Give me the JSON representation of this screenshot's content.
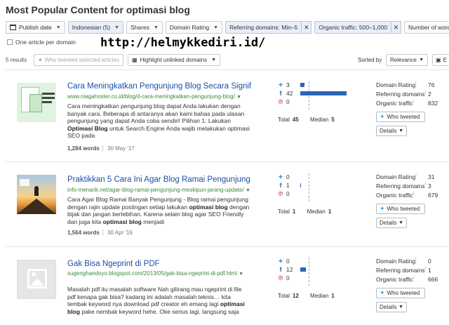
{
  "title": "Most Popular Content for optimasi blog",
  "filters": {
    "publish_date": "Publish date",
    "language": "Indonesian (5)",
    "shares": "Shares",
    "domain_rating": "Domain Rating",
    "referring_domains": "Referring domains: Min–5",
    "organic_traffic": "Organic traffic: 500–1,000",
    "number_of_words": "Number of words"
  },
  "one_article_per_domain": "One article per domain",
  "watermark": "http://helmykkediri.id/",
  "toolbar": {
    "results": "5 results",
    "who_tweeted_selected": "Who tweeted selected articles",
    "highlight_unlinked": "Highlight unlinked domains",
    "sorted_by": "Sorted by",
    "sort_value": "Relevance",
    "export": "E"
  },
  "labels": {
    "total": "Total",
    "median": "Median",
    "domain_rating": "Domain Rating",
    "referring_domains": "Referring domains",
    "organic_traffic": "Organic traffic",
    "who_tweeted": "Who tweeted",
    "details": "Details"
  },
  "articles": [
    {
      "title": "Cara Meningkatkan Pengunjung Blog Secara Signifi…",
      "url": "www.niagahoster.co.id/blog/4-cara-meningkatkan-pengunjung-blog/",
      "desc_1": "Cara meningkatkan pengunjung blog dapat Anda lakukan dengan banyak cara. Beberapa di antaranya akan kami bahas pada ulasan pengunjung yang dapat Anda coba sendiri! Pilihan 1: Lakukan ",
      "desc_bold_1": "Optimasi Blog",
      "desc_2": " untuk Search Engine Anda wajib melakukan optimasi SEO pada",
      "words": "1,284 words",
      "date": "30 May '17",
      "twitter": "3",
      "facebook": "42",
      "pinterest": "0",
      "total": "45",
      "median": "5",
      "domain_rating": "76",
      "referring_domains": "2",
      "organic_traffic": "832",
      "fb_share": 0.933
    },
    {
      "title": "Praktikkan 5 Cara Ini Agar Blog Ramai Pengunjung …",
      "url": "info-menarik.net/agar-blog-ramai-pengunjung-meskipun-jarang-update/",
      "desc_1": "Cara Agar Blog Ramai Banyak Pengunjung - Blog ramai pengunjung dengan rajin update postingan setiap lakukan ",
      "desc_bold_1": "optimasi blog",
      "desc_2": " dengan bijak dan jangan berlebihan. Karena selain blog agar SEO Friendly dan juga kita ",
      "desc_bold_2": "optimasi blog",
      "desc_3": " menjadi",
      "words": "1,564 words",
      "date": "30 Apr '16",
      "twitter": "0",
      "facebook": "1",
      "pinterest": "0",
      "total": "1",
      "median": "1",
      "domain_rating": "31",
      "referring_domains": "3",
      "organic_traffic": "679",
      "fb_share": 1.0
    },
    {
      "title": "Gak Bisa Ngeprint di PDF",
      "url": "sugenghandoyo.blogspot.com/2013/05/gak-bisa-ngeprint-di-pdf.html",
      "desc_1": "Masalah pdf itu masalah software Nah gilirang mau ngeprint di file pdf kenapa gak bisa? kadang ini adalah masalah teknis… kita tembak keyword nya download pdf creator eh emang lagi ",
      "desc_bold_1": "optimasi blog",
      "desc_2": " pake nembak keyword hehe. Oke serius lagi, langsung saja",
      "words": "",
      "date": "",
      "twitter": "0",
      "facebook": "12",
      "pinterest": "0",
      "total": "12",
      "median": "1",
      "domain_rating": "0",
      "referring_domains": "1",
      "organic_traffic": "666",
      "fb_share": 1.0
    }
  ],
  "icons": {
    "twitter": "twitter-icon",
    "facebook": "facebook-icon",
    "pinterest": "pinterest-icon",
    "calendar": "calendar-icon"
  },
  "colors": {
    "title_link": "#1d4fa3",
    "url_green": "#3a8a3a",
    "bar_blue": "#2a65b8",
    "twitter": "#3fa4e8"
  }
}
